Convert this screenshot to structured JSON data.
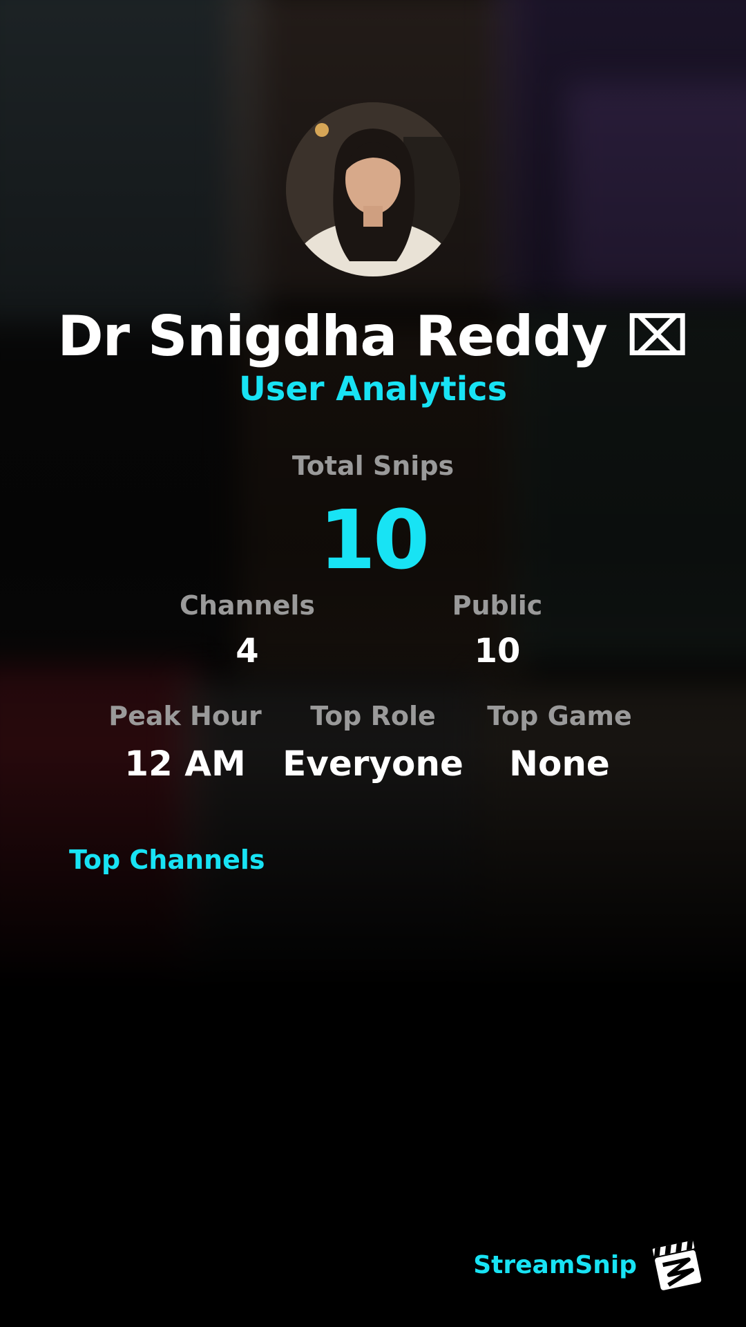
{
  "profile": {
    "display_name": "Dr Snigdha Reddy ⌧",
    "subtitle": "User Analytics",
    "avatar_icon": "profile-photo"
  },
  "stats": {
    "total_snips_label": "Total Snips",
    "total_snips_value": "10",
    "channels_label": "Channels",
    "channels_value": "4",
    "public_label": "Public",
    "public_value": "10",
    "peak_hour_label": "Peak Hour",
    "peak_hour_value": "12 AM",
    "top_role_label": "Top Role",
    "top_role_value": "Everyone",
    "top_game_label": "Top Game",
    "top_game_value": "None"
  },
  "sections": {
    "top_channels_title": "Top Channels"
  },
  "brand": {
    "name": "StreamSnip",
    "logo_icon": "clapperboard-icon"
  },
  "colors": {
    "accent": "#18e3f4",
    "label_gray": "#9a9a9a",
    "background": "#000000"
  }
}
